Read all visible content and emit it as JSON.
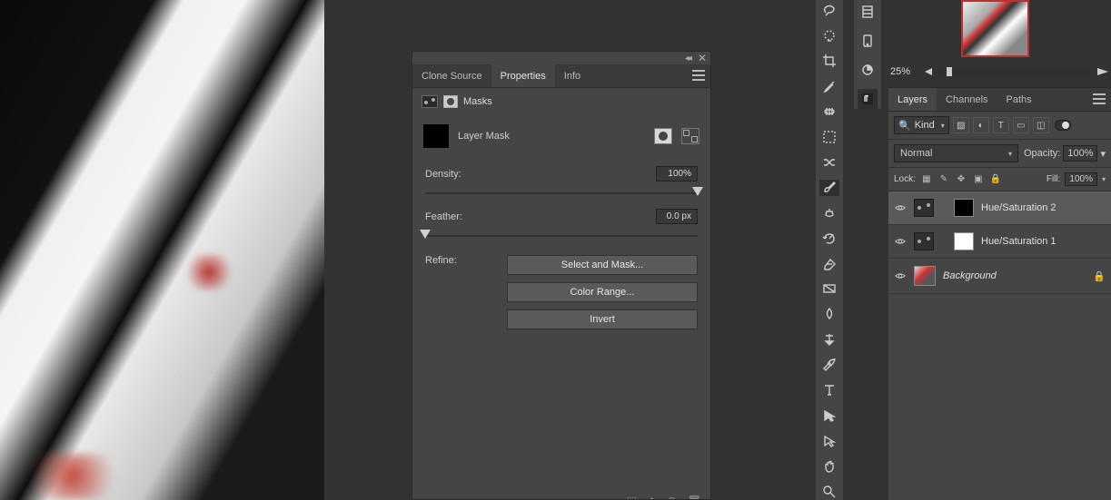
{
  "panel": {
    "tabs": {
      "clone": "Clone Source",
      "properties": "Properties",
      "info": "Info"
    },
    "sub": {
      "label": "Masks"
    },
    "maskrow": {
      "label": "Layer Mask"
    },
    "density": {
      "label": "Density:",
      "value": "100%",
      "pos": 100
    },
    "feather": {
      "label": "Feather:",
      "value": "0.0 px",
      "pos": 0
    },
    "refine": {
      "label": "Refine:",
      "selectmask": "Select and Mask...",
      "colorrange": "Color Range...",
      "invert": "Invert"
    }
  },
  "nav": {
    "zoom": "25%"
  },
  "layers": {
    "tabs": {
      "layers": "Layers",
      "channels": "Channels",
      "paths": "Paths"
    },
    "kind": "Kind",
    "blend": {
      "mode": "Normal",
      "opacity_label": "Opacity:",
      "opacity_val": "100%"
    },
    "lock": {
      "label": "Lock:",
      "fill_label": "Fill:",
      "fill_val": "100%"
    },
    "items": [
      {
        "name": "Hue/Saturation 2"
      },
      {
        "name": "Hue/Saturation 1"
      },
      {
        "name": "Background"
      }
    ]
  }
}
